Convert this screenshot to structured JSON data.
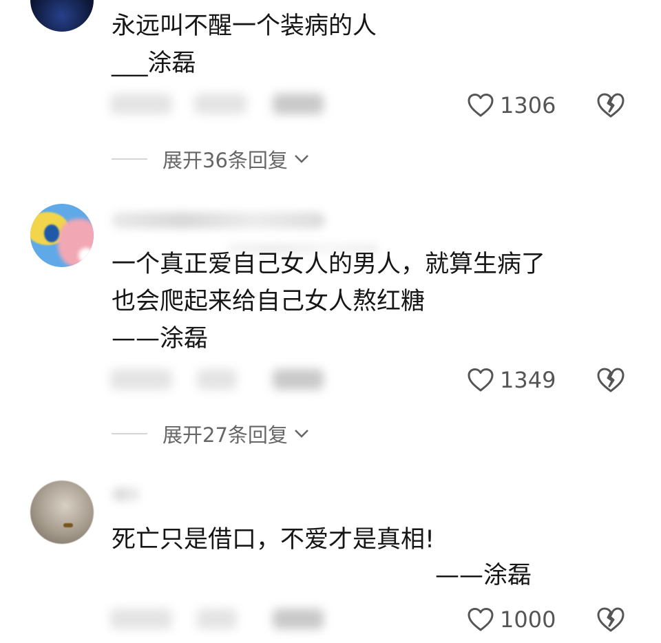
{
  "comments": [
    {
      "lines": [
        "永远叫不醒一个装病的人",
        "___涂磊"
      ],
      "likes": "1306",
      "expand_label": "展开36条回复"
    },
    {
      "lines": [
        "一个真正爱自己女人的男人，就算生病了",
        "也会爬起来给自己女人熬红糖",
        "——涂磊"
      ],
      "likes": "1349",
      "expand_label": "展开27条回复"
    },
    {
      "lines": [
        "死亡只是借口，不爱才是真相!",
        "——涂磊"
      ],
      "likes": "1000"
    }
  ],
  "icons": {
    "like": "heart-outline-icon",
    "dislike": "broken-heart-icon",
    "expand": "chevron-down-icon"
  },
  "colors": {
    "text": "#161616",
    "meta": "#555555",
    "expand": "#666666"
  }
}
